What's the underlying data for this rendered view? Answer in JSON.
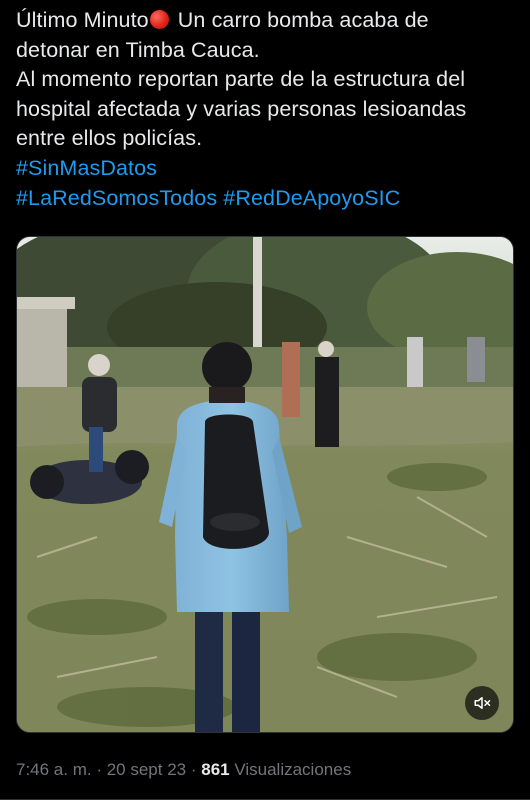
{
  "tweet": {
    "line1_a": "Último Minuto",
    "line1_b": " Un carro bomba acaba de",
    "line2": "detonar en Timba Cauca.",
    "line3": "Al momento reportan parte de la estructura del",
    "line4": "hospital afectada y varias personas lesioandas",
    "line5": "entre ellos policías.",
    "hashtag1": "#SinMasDatos",
    "hashtag2": "#LaRedSomosTodos",
    "hashtag3": "#RedDeApoyoSIC",
    "emoji": "red-circle-emoji"
  },
  "video": {
    "mute_icon": "speaker-muted-icon"
  },
  "meta": {
    "time": "7:46 a. m.",
    "sep1": " · ",
    "date": "20 sept 23",
    "sep2": " · ",
    "views_count": "861",
    "views_label": " Visualizaciones"
  },
  "colors": {
    "background": "#000000",
    "text": "#e7e9ea",
    "link": "#1d9bf0",
    "muted": "#71767b",
    "border": "#2f3336"
  }
}
